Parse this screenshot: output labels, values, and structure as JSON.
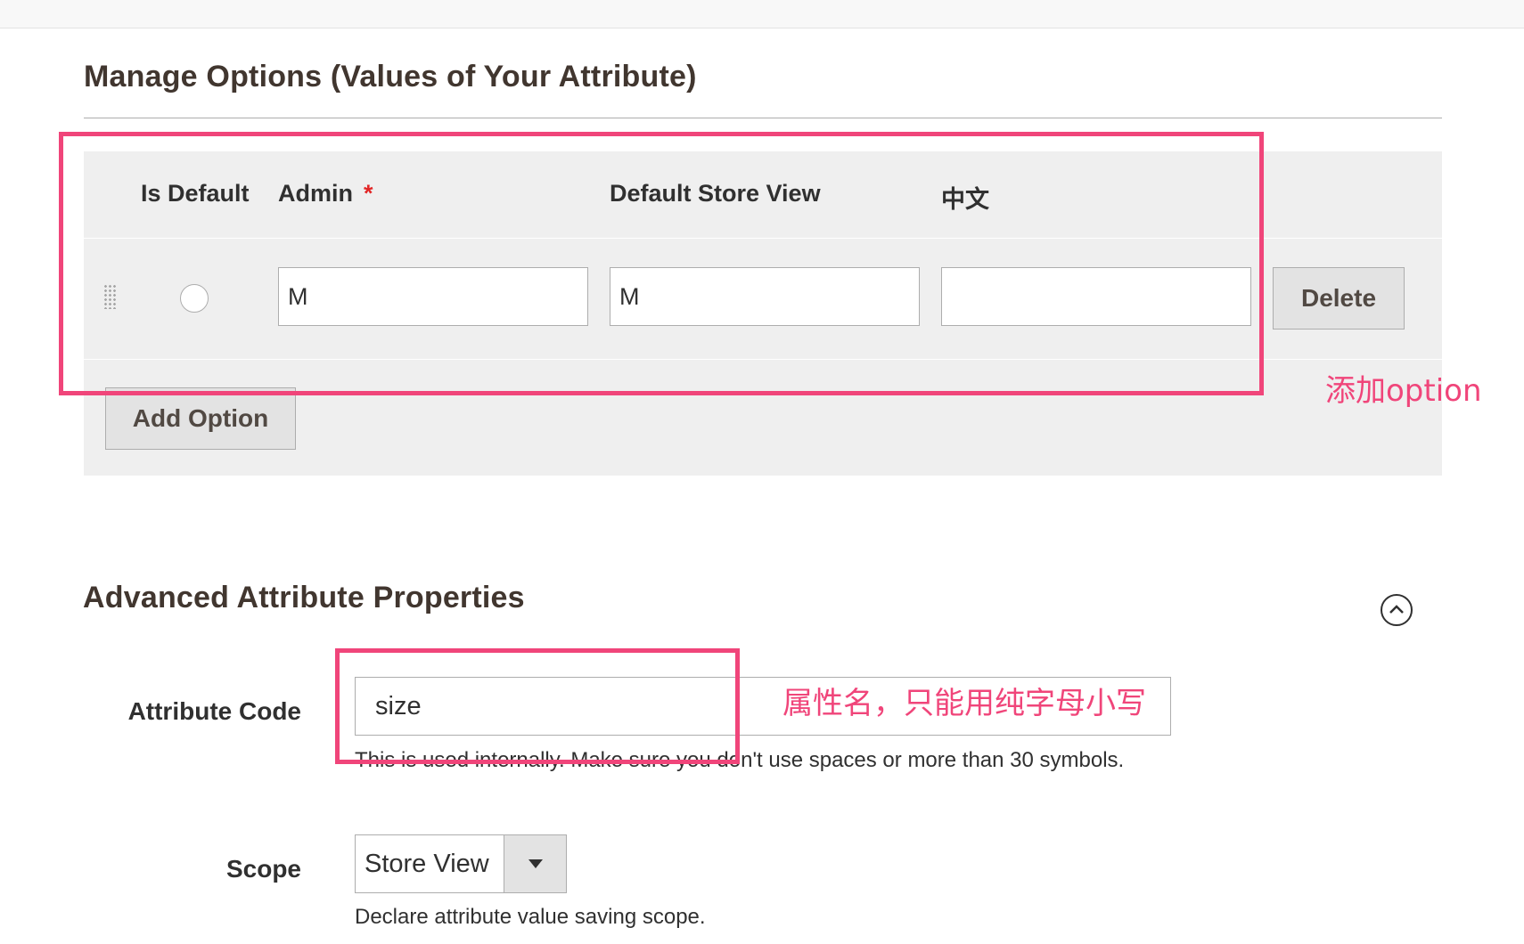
{
  "manage_options": {
    "title": "Manage Options (Values of Your Attribute)",
    "columns": {
      "is_default": "Is Default",
      "admin": "Admin",
      "required_marker": "*",
      "default_store_view": "Default Store View",
      "chinese": "中文"
    },
    "rows": [
      {
        "admin": "M",
        "default_store_view": "M",
        "chinese": ""
      }
    ],
    "delete_label": "Delete",
    "add_option_label": "Add Option"
  },
  "annotations": {
    "add_option_note": "添加option",
    "attribute_code_note": "属性名，只能用纯字母小写",
    "color": "#f0457a"
  },
  "advanced": {
    "title": "Advanced Attribute Properties",
    "collapse_icon": "chevron-up-circle-icon",
    "attribute_code": {
      "label": "Attribute Code",
      "value": "size",
      "note": "This is used internally. Make sure you don't use spaces or more than 30 symbols."
    },
    "scope": {
      "label": "Scope",
      "selected": "Store View",
      "note": "Declare attribute value saving scope."
    }
  }
}
